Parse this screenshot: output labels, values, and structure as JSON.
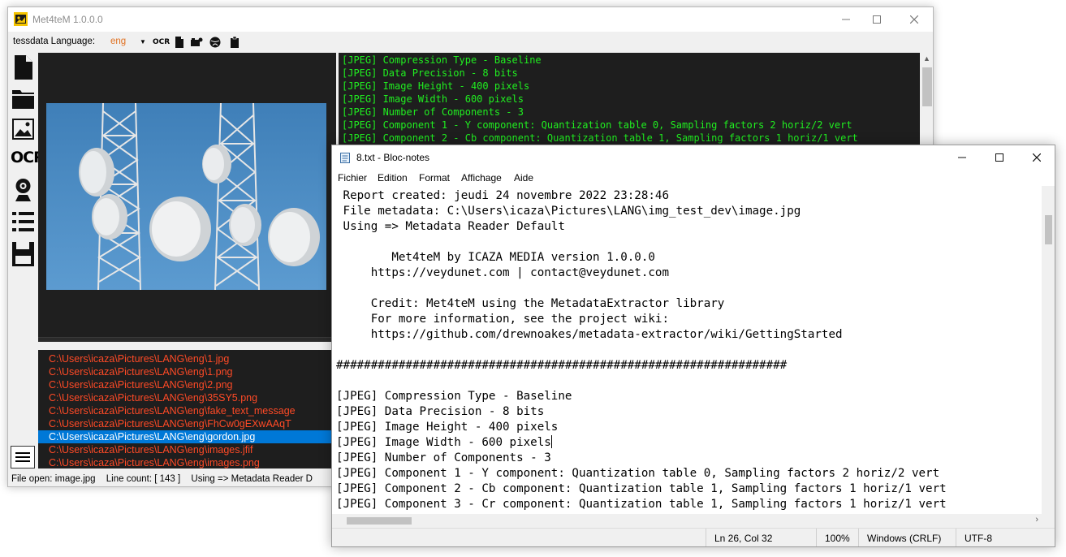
{
  "app": {
    "title": "Met4teM 1.0.0.0",
    "toolbar": {
      "tessdata_label": "tessdata Language:",
      "language": "eng",
      "ocr_label": "OCR"
    },
    "sidebar": {
      "ocr_label": "OCR"
    },
    "metadata_lines": [
      "[JPEG] Compression Type - Baseline",
      "[JPEG] Data Precision - 8 bits",
      "[JPEG] Image Height - 400 pixels",
      "[JPEG] Image Width - 600 pixels",
      "[JPEG] Number of Components - 3",
      "[JPEG] Component 1 - Y component: Quantization table 0, Sampling factors 2 horiz/2 vert",
      "[JPEG] Component 2 - Cb component: Quantization table 1, Sampling factors 1 horiz/1 vert"
    ],
    "files": [
      "C:\\Users\\icaza\\Pictures\\LANG\\eng\\1.jpg",
      "C:\\Users\\icaza\\Pictures\\LANG\\eng\\1.png",
      "C:\\Users\\icaza\\Pictures\\LANG\\eng\\2.png",
      "C:\\Users\\icaza\\Pictures\\LANG\\eng\\35SY5.png",
      "C:\\Users\\icaza\\Pictures\\LANG\\eng\\fake_text_message",
      "C:\\Users\\icaza\\Pictures\\LANG\\eng\\FhCw0gEXwAAqT",
      "C:\\Users\\icaza\\Pictures\\LANG\\eng\\gordon.jpg",
      "C:\\Users\\icaza\\Pictures\\LANG\\eng\\images.jfif",
      "C:\\Users\\icaza\\Pictures\\LANG\\eng\\images.png"
    ],
    "selected_file_index": 6,
    "status": {
      "file_open": "File open: image.jpg",
      "line_count": "Line count: [ 143 ]",
      "using": "Using => Metadata Reader D"
    },
    "colors": {
      "file_text": "#ff4a26",
      "meta_text": "#20ee20",
      "selection": "#0078d7",
      "language": "#e07020"
    }
  },
  "notepad": {
    "title": "8.txt - Bloc-notes",
    "menu": [
      "Fichier",
      "Edition",
      "Format",
      "Affichage",
      "Aide"
    ],
    "lines": [
      " Report created: jeudi 24 novembre 2022 23:28:46",
      " File metadata: C:\\Users\\icaza\\Pictures\\LANG\\img_test_dev\\image.jpg",
      " Using => Metadata Reader Default",
      "",
      "        Met4teM by ICAZA MEDIA version 1.0.0.0",
      "     https://veydunet.com | contact@veydunet.com",
      "",
      "     Credit: Met4teM using the MetadataExtractor library",
      "     For more information, see the project wiki:",
      "     https://github.com/drewnoakes/metadata-extractor/wiki/GettingStarted",
      "",
      "#################################################################",
      "",
      "[JPEG] Compression Type - Baseline",
      "[JPEG] Data Precision - 8 bits",
      "[JPEG] Image Height - 400 pixels",
      "[JPEG] Image Width - 600 pixels",
      "[JPEG] Number of Components - 3",
      "[JPEG] Component 1 - Y component: Quantization table 0, Sampling factors 2 horiz/2 vert",
      "[JPEG] Component 2 - Cb component: Quantization table 1, Sampling factors 1 horiz/1 vert",
      "[JPEG] Component 3 - Cr component: Quantization table 1, Sampling factors 1 horiz/1 vert"
    ],
    "caret_line_index": 16,
    "status": {
      "position": "Ln 26, Col 32",
      "zoom": "100%",
      "line_ending": "Windows (CRLF)",
      "encoding": "UTF-8"
    }
  }
}
